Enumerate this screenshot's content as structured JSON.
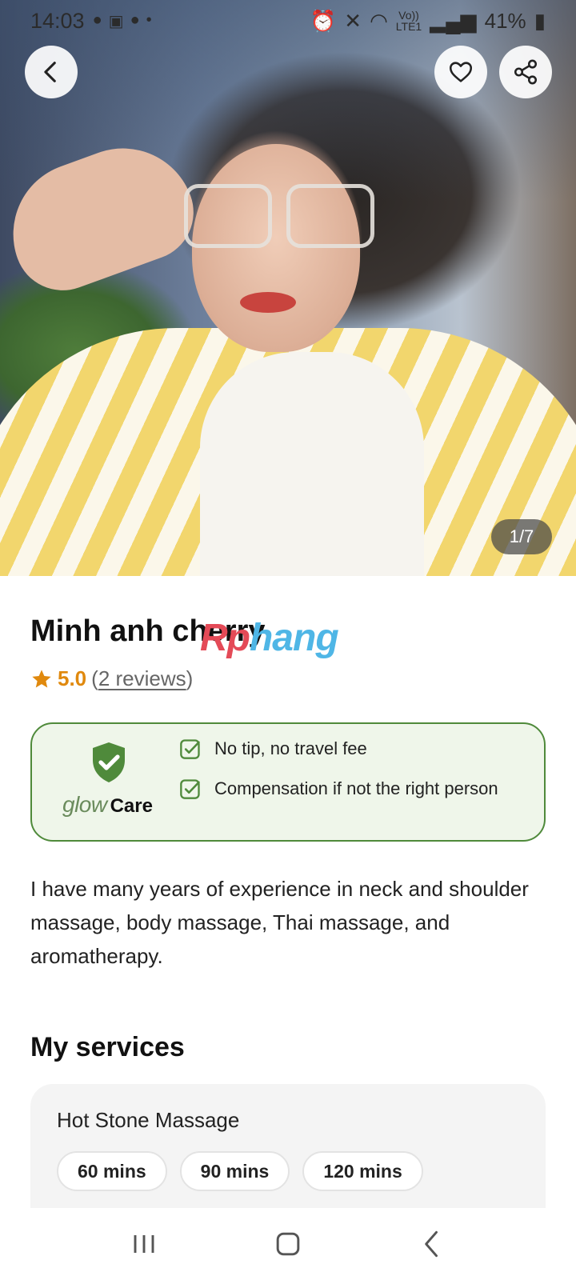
{
  "status_bar": {
    "time": "14:03",
    "network_label": "Vo))\nLTE1",
    "battery": "41%"
  },
  "hero": {
    "photo_counter": "1/7"
  },
  "profile": {
    "name": "Minh anh cherry",
    "rating": "5.0",
    "reviews_open": "(",
    "reviews_link": "2 reviews",
    "reviews_close": ")"
  },
  "watermark": {
    "part1": "Rp",
    "part2": "hang"
  },
  "care": {
    "logo_word1": "glow",
    "logo_word2": "Care",
    "items": [
      "No tip, no travel fee",
      "Compensation if not the right person"
    ],
    "accent_color": "#4f8a3b"
  },
  "bio": "I have many years of experience in neck and shoulder massage, body massage, Thai massage, and aromatherapy.",
  "services": {
    "title": "My services",
    "items": [
      {
        "name": "Hot Stone Massage",
        "durations": [
          "60 mins",
          "90 mins",
          "120 mins"
        ]
      }
    ]
  },
  "colors": {
    "rating": "#e0890e",
    "care_background": "#eff6ea"
  }
}
